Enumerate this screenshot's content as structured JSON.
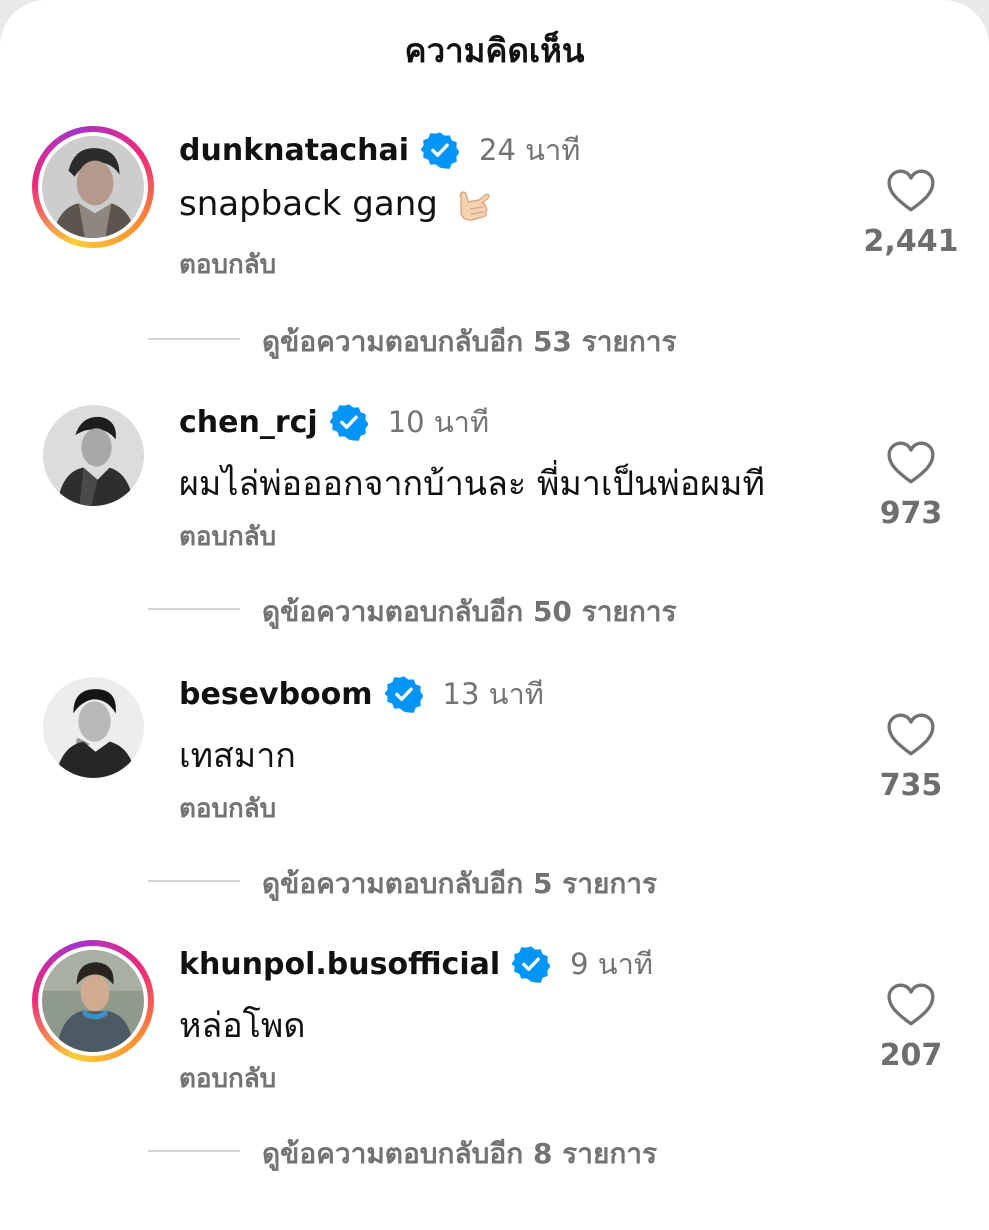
{
  "sheet": {
    "title": "ความคิดเห็น"
  },
  "reply_label": "ตอบกลับ",
  "comments": [
    {
      "username": "dunknatachai",
      "verified": true,
      "time": "24 นาที",
      "text": "snapback gang",
      "emoji": "call-me-hand",
      "likes": "2,441",
      "story_ring": true,
      "more_replies": "ดูข้อความตอบกลับอีก 53 รายการ"
    },
    {
      "username": "chen_rcj",
      "verified": true,
      "time": "10 นาที",
      "text": "ผมไล่พ่อออกจากบ้านละ พี่มาเป็นพ่อผมที",
      "likes": "973",
      "story_ring": false,
      "more_replies": "ดูข้อความตอบกลับอีก 50 รายการ"
    },
    {
      "username": "besevboom",
      "verified": true,
      "time": "13 นาที",
      "text": "เทสมาก",
      "likes": "735",
      "story_ring": false,
      "more_replies": "ดูข้อความตอบกลับอีก 5 รายการ"
    },
    {
      "username": "khunpol.busofficial",
      "verified": true,
      "time": "9 นาที",
      "text": "หล่อโพด",
      "likes": "207",
      "story_ring": true,
      "more_replies": "ดูข้อความตอบกลับอีก 8 รายการ"
    }
  ],
  "colors": {
    "verified_blue": "#0095f6",
    "secondary_text": "#737373",
    "story_ring": [
      "#f9ce34",
      "#ee2a7b",
      "#a435c9"
    ]
  },
  "icons": {
    "like": "heart-outline-icon",
    "verified": "verified-badge-icon"
  }
}
